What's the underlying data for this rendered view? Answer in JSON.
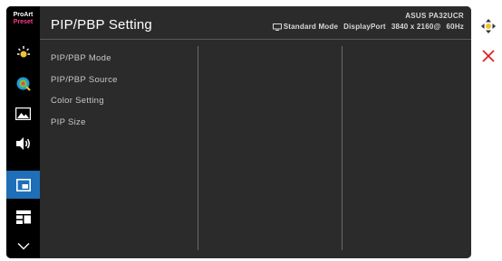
{
  "brand": {
    "line1": "ProArt",
    "line2": "Preset"
  },
  "header": {
    "title": "PIP/PBP Setting",
    "model": "ASUS PA32UCR",
    "mode": "Standard Mode",
    "input": "DisplayPort",
    "resolution": "3840 x 2160@",
    "refresh": "60Hz"
  },
  "menu": {
    "items": [
      {
        "label": "PIP/PBP Mode"
      },
      {
        "label": "PIP/PBP Source"
      },
      {
        "label": "Color Setting"
      },
      {
        "label": "PIP Size"
      }
    ]
  },
  "sidebar": {
    "items": [
      {
        "icon": "proart-preset-icon"
      },
      {
        "icon": "brightness-icon"
      },
      {
        "icon": "color-icon"
      },
      {
        "icon": "image-icon"
      },
      {
        "icon": "sound-icon"
      },
      {
        "icon": "pip-pbp-icon",
        "active": true
      },
      {
        "icon": "system-setup-icon"
      },
      {
        "icon": "chevron-down-icon"
      }
    ]
  },
  "controls": {
    "navigate": "move-icon",
    "close": "close-icon"
  },
  "colors": {
    "active": "#1e6fb8",
    "panel": "#2b2b2b",
    "close": "#e02020"
  }
}
